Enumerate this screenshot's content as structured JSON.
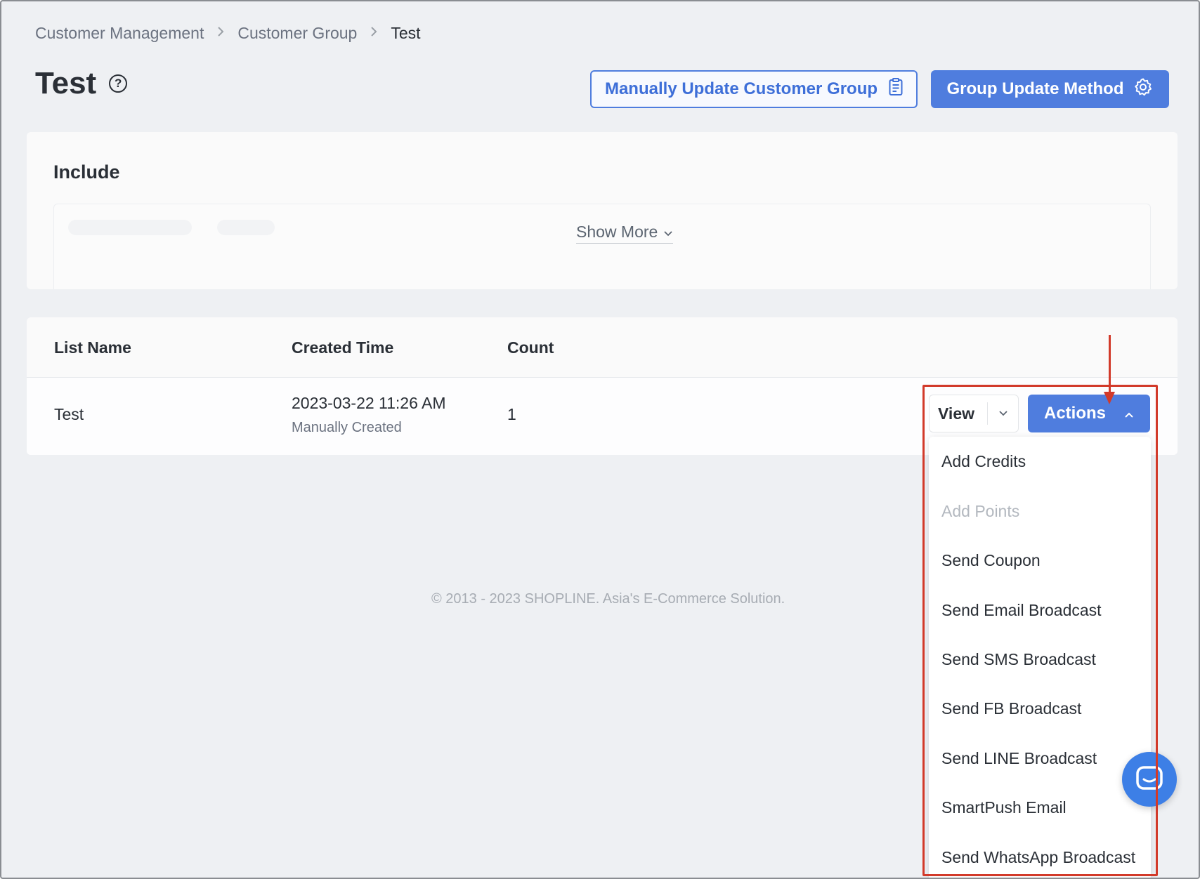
{
  "breadcrumb": {
    "items": [
      "Customer Management",
      "Customer Group",
      "Test"
    ]
  },
  "header": {
    "title": "Test",
    "manual_update_label": "Manually Update Customer Group",
    "group_update_label": "Group Update Method"
  },
  "include": {
    "title": "Include",
    "show_more_label": "Show More"
  },
  "table": {
    "columns": [
      "List Name",
      "Created Time",
      "Count"
    ],
    "rows": [
      {
        "name": "Test",
        "created_time": "2023-03-22 11:26 AM",
        "created_note": "Manually Created",
        "count": "1"
      }
    ],
    "view_label": "View",
    "actions_label": "Actions"
  },
  "actions_menu": {
    "items": [
      {
        "label": "Add Credits",
        "disabled": false
      },
      {
        "label": "Add Points",
        "disabled": true
      },
      {
        "label": "Send Coupon",
        "disabled": false
      },
      {
        "label": "Send Email Broadcast",
        "disabled": false
      },
      {
        "label": "Send SMS Broadcast",
        "disabled": false
      },
      {
        "label": "Send FB Broadcast",
        "disabled": false
      },
      {
        "label": "Send LINE Broadcast",
        "disabled": false
      },
      {
        "label": "SmartPush Email",
        "disabled": false
      },
      {
        "label": "Send WhatsApp Broadcast",
        "disabled": false
      }
    ]
  },
  "footer": {
    "copyright": "© 2013 - 2023 SHOPLINE. Asia's E-Commerce Solution."
  },
  "colors": {
    "primary": "#4f7dde",
    "annotation": "#d23a2a",
    "chat": "#3d7fe6"
  },
  "icons": {
    "help": "question-circle-icon",
    "manual_update": "clipboard-icon",
    "group_update": "gear-icon",
    "show_more": "chevron-down-icon",
    "view_dropdown": "chevron-down-icon",
    "actions_toggle": "chevron-up-icon",
    "chat": "chat-icon"
  }
}
